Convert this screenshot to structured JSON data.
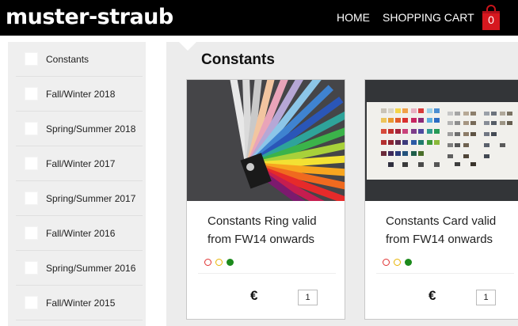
{
  "header": {
    "logo": "muster-straub",
    "nav": {
      "home": "HOME",
      "cart": "SHOPPING CART"
    },
    "cart_count": "0"
  },
  "sidebar": {
    "items": [
      {
        "label": "Constants"
      },
      {
        "label": "Fall/Winter 2018"
      },
      {
        "label": "Spring/Summer 2018"
      },
      {
        "label": "Fall/Winter 2017"
      },
      {
        "label": "Spring/Summer 2017"
      },
      {
        "label": "Fall/Winter 2016"
      },
      {
        "label": "Spring/Summer 2016"
      },
      {
        "label": "Fall/Winter 2015"
      }
    ]
  },
  "main": {
    "title": "Constants",
    "products": [
      {
        "title": "Constants Ring valid from FW14 onwards",
        "price": "€",
        "quantity": "1"
      },
      {
        "title": "Constants Card valid from FW14 onwards",
        "price": "€",
        "quantity": "1"
      }
    ]
  },
  "colors": {
    "header_bg": "#000000",
    "cart_red": "#d6181f",
    "dot_red": "#e03030",
    "dot_yellow": "#e8b400",
    "dot_green": "#1c8a1c"
  }
}
